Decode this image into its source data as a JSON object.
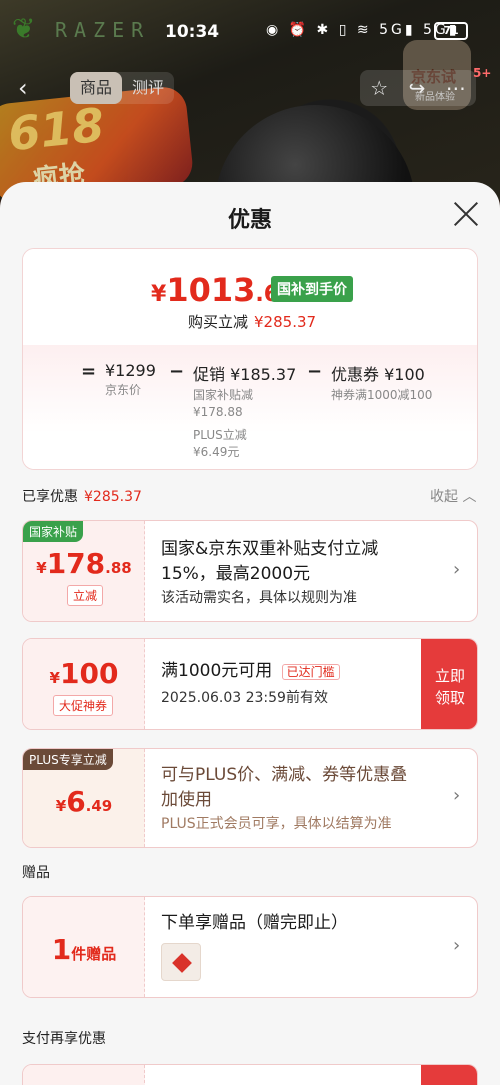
{
  "status_bar": {
    "brand": "RAZER",
    "time": "10:34",
    "icons": "◉ ⏰ ✱ ▯ ≋ 5G▮ 5G▮",
    "battery": "71"
  },
  "product_page": {
    "promo_big": "618",
    "promo_small": "疯抢",
    "badge_text": "京东试",
    "badge_sub": "新品体验",
    "tabs": [
      "商品",
      "测评"
    ],
    "cart_count": "5+"
  },
  "sheet": {
    "title": "优惠",
    "price": {
      "currency": "¥",
      "integer": "1013",
      "decimal": ".63",
      "tag": "国补到手价",
      "cut_label": "购买立减",
      "cut_value": "¥285.37"
    },
    "breakdown": {
      "eq": "=",
      "jd_price": "¥1299",
      "jd_price_label": "京东价",
      "minus1": "−",
      "promo": "促销 ¥185.37",
      "promo_sub1": "国家补贴减",
      "promo_sub1_val": "¥178.88",
      "promo_sub2": "PLUS立减",
      "promo_sub2_val": "¥6.49元",
      "minus2": "−",
      "coupon": "优惠券 ¥100",
      "coupon_sub": "神券满1000减100"
    },
    "enjoyed_label": "已享优惠",
    "enjoyed_value": "¥285.37",
    "collapse": "收起 ︿",
    "offers": {
      "subsidy": {
        "corner": "国家补贴",
        "cur": "¥",
        "int": "178",
        "dec": ".88",
        "chip": "立减",
        "line1": "国家&京东双重补贴支付立减",
        "line2": "15%，最高2000元",
        "line3": "该活动需实名，具体以规则为准"
      },
      "coupon": {
        "cur": "¥",
        "int": "100",
        "chip": "大促神券",
        "line1": "满1000元可用",
        "reached": "已达门槛",
        "line2": "2025.06.03 23:59前有效",
        "claim1": "立即",
        "claim2": "领取"
      },
      "plus": {
        "corner": "PLUS专享立减",
        "cur": "¥",
        "int": "6",
        "dec": ".49",
        "line1": "可与PLUS价、满减、券等优惠叠",
        "line2": "加使用",
        "line3": "PLUS正式会员可享，具体以结算为准"
      }
    },
    "gift_section": "赠品",
    "gift": {
      "count": "1",
      "label": "件赠品",
      "title": "下单享赠品（赠完即止）"
    },
    "pay_section": "支付再享优惠"
  },
  "colors": {
    "accent_red": "#e22a1c",
    "tag_green": "#3aa14b",
    "claim_red": "#e53b3b",
    "plus_brown": "#6b4a38"
  }
}
